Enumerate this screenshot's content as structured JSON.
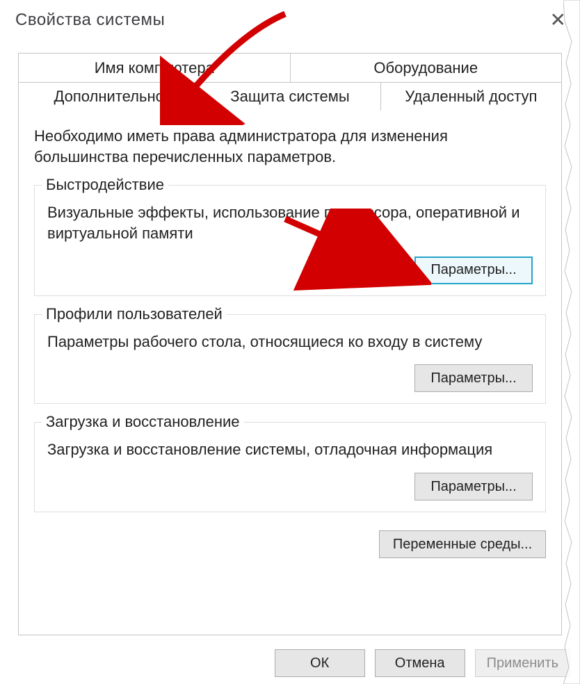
{
  "window": {
    "title": "Свойства системы"
  },
  "tabs": {
    "row1": [
      {
        "label": "Имя компьютера"
      },
      {
        "label": "Оборудование"
      }
    ],
    "row2": [
      {
        "label": "Дополнительно",
        "active": true
      },
      {
        "label": "Защита системы"
      },
      {
        "label": "Удаленный доступ"
      }
    ]
  },
  "page": {
    "admin_note": "Необходимо иметь права администратора для изменения большинства перечисленных параметров.",
    "groups": {
      "performance": {
        "legend": "Быстродействие",
        "desc": "Визуальные эффекты, использование процессора, оперативной и виртуальной памяти",
        "button": "Параметры..."
      },
      "profiles": {
        "legend": "Профили пользователей",
        "desc": "Параметры рабочего стола, относящиеся ко входу в систему",
        "button": "Параметры..."
      },
      "startup": {
        "legend": "Загрузка и восстановление",
        "desc": "Загрузка и восстановление системы, отладочная информация",
        "button": "Параметры..."
      }
    },
    "env_button": "Переменные среды..."
  },
  "dialog_buttons": {
    "ok": "ОК",
    "cancel": "Отмена",
    "apply": "Применить"
  }
}
